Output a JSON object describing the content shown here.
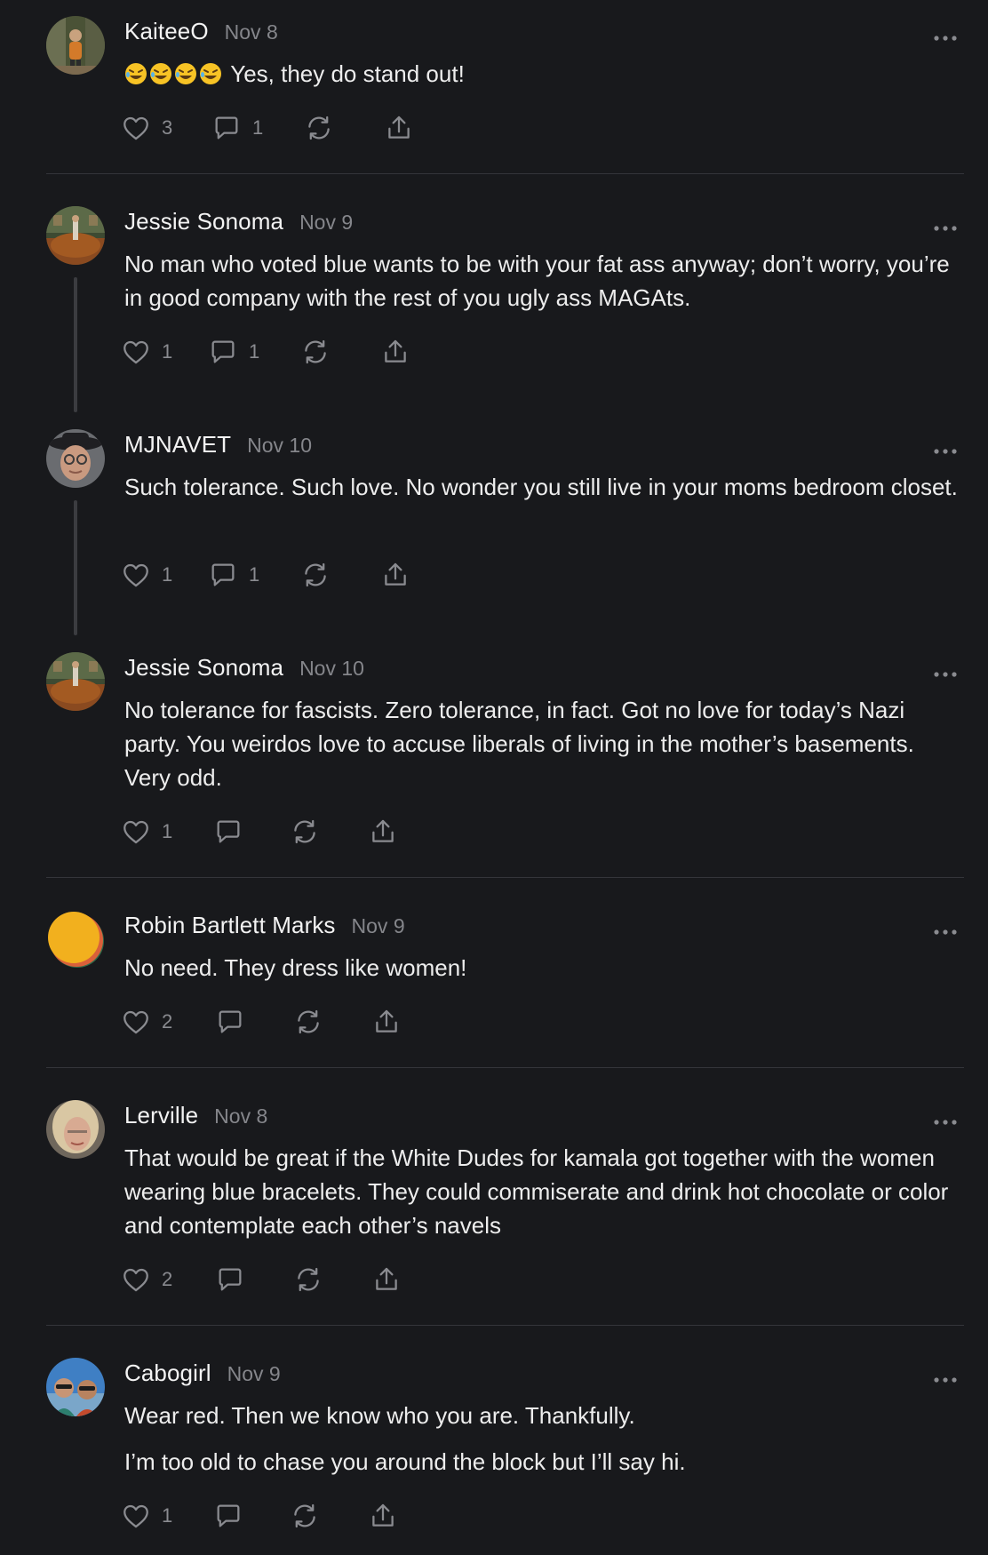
{
  "posts": [
    {
      "author": "KaiteeO",
      "date": "Nov 8",
      "paragraphs": [
        "Yes, they do stand out!"
      ],
      "emoji_prefix": "rolling-on-floor-laughing-emoji x4",
      "likes": "3",
      "replies": "1",
      "thread_line": false
    },
    {
      "author": "Jessie Sonoma",
      "date": "Nov 9",
      "paragraphs": [
        "No man who voted blue wants to be with your fat ass anyway; don’t worry, you’re in good company with the rest of you ugly ass MAGAts."
      ],
      "likes": "1",
      "replies": "1",
      "thread_line": true
    },
    {
      "author": "MJNAVET",
      "date": "Nov 10",
      "paragraphs": [
        "Such tolerance. Such love. No wonder you still live in your moms bedroom closet."
      ],
      "likes": "1",
      "replies": "1",
      "thread_line": true
    },
    {
      "author": "Jessie Sonoma",
      "date": "Nov 10",
      "paragraphs": [
        "No tolerance for fascists. Zero tolerance, in fact. Got no love for today’s Nazi party. You weirdos love to accuse liberals of living in the mother’s basements. Very odd."
      ],
      "likes": "1",
      "replies": "",
      "thread_line": false
    },
    {
      "author": "Robin Bartlett Marks",
      "date": "Nov 9",
      "paragraphs": [
        "No need. They dress like women!"
      ],
      "likes": "2",
      "replies": "",
      "thread_line": false
    },
    {
      "author": "Lerville",
      "date": "Nov 8",
      "paragraphs": [
        "That would be great if the White Dudes for kamala got together with the women wearing blue bracelets. They could commiserate and drink hot chocolate or color and contemplate each other’s navels"
      ],
      "likes": "2",
      "replies": "",
      "thread_line": false
    },
    {
      "author": "Cabogirl",
      "date": "Nov 9",
      "paragraphs": [
        "Wear red. Then we know who you are. Thankfully.",
        "I’m too old to chase you around the block but I’ll say hi."
      ],
      "likes": "1",
      "replies": "",
      "thread_line": false
    }
  ],
  "icons": {
    "like": "heart-icon",
    "reply": "comment-bubble-icon",
    "restack": "restack-icon",
    "share": "share-icon",
    "more": "more-options-icon"
  },
  "colors": {
    "background": "#18191c",
    "text": "#ededed",
    "muted": "#85868b",
    "divider": "#34353a"
  }
}
